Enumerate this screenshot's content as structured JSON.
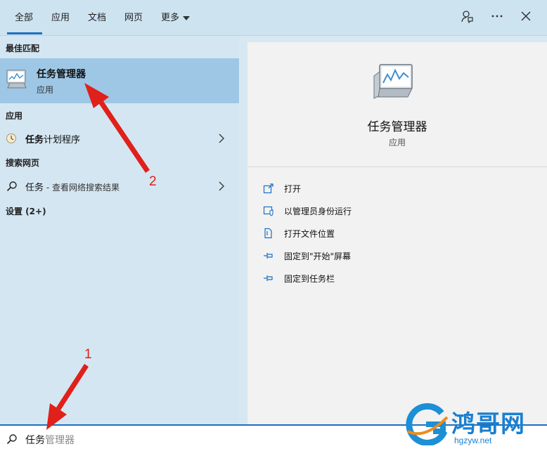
{
  "tabs": [
    {
      "label": "全部",
      "active": true
    },
    {
      "label": "应用"
    },
    {
      "label": "文档"
    },
    {
      "label": "网页"
    },
    {
      "label": "更多"
    }
  ],
  "top_icons": [
    "feedback-icon",
    "more-icon",
    "close-icon"
  ],
  "left": {
    "best_match_label": "最佳匹配",
    "best_match": {
      "title": "任务管理器",
      "subtitle": "应用",
      "icon": "task-manager-icon"
    },
    "apps_label": "应用",
    "apps": [
      {
        "bold": "任务",
        "rest": "计划程序",
        "icon": "scheduler-icon"
      }
    ],
    "web_label": "搜索网页",
    "web": [
      {
        "bold": "任务",
        "rest": " - 查看网络搜索结果",
        "icon": "search-icon"
      }
    ],
    "settings_label": "设置 (2+)"
  },
  "preview": {
    "title": "任务管理器",
    "subtitle": "应用",
    "actions": [
      {
        "label": "打开",
        "icon": "open-icon"
      },
      {
        "label": "以管理员身份运行",
        "icon": "admin-shield-icon"
      },
      {
        "label": "打开文件位置",
        "icon": "file-location-icon"
      },
      {
        "label": "固定到\"开始\"屏幕",
        "icon": "pin-icon"
      },
      {
        "label": "固定到任务栏",
        "icon": "pin-icon"
      }
    ]
  },
  "search": {
    "typed": "任务",
    "suggestion": "管理器"
  },
  "annotations": {
    "one": "1",
    "two": "2"
  },
  "watermark": {
    "brand": "鸿哥网",
    "domain": "hgzyw.net"
  },
  "colors": {
    "accent": "#1c6fc2",
    "highlight": "#9ec7e6",
    "annotation": "#e0201a"
  }
}
